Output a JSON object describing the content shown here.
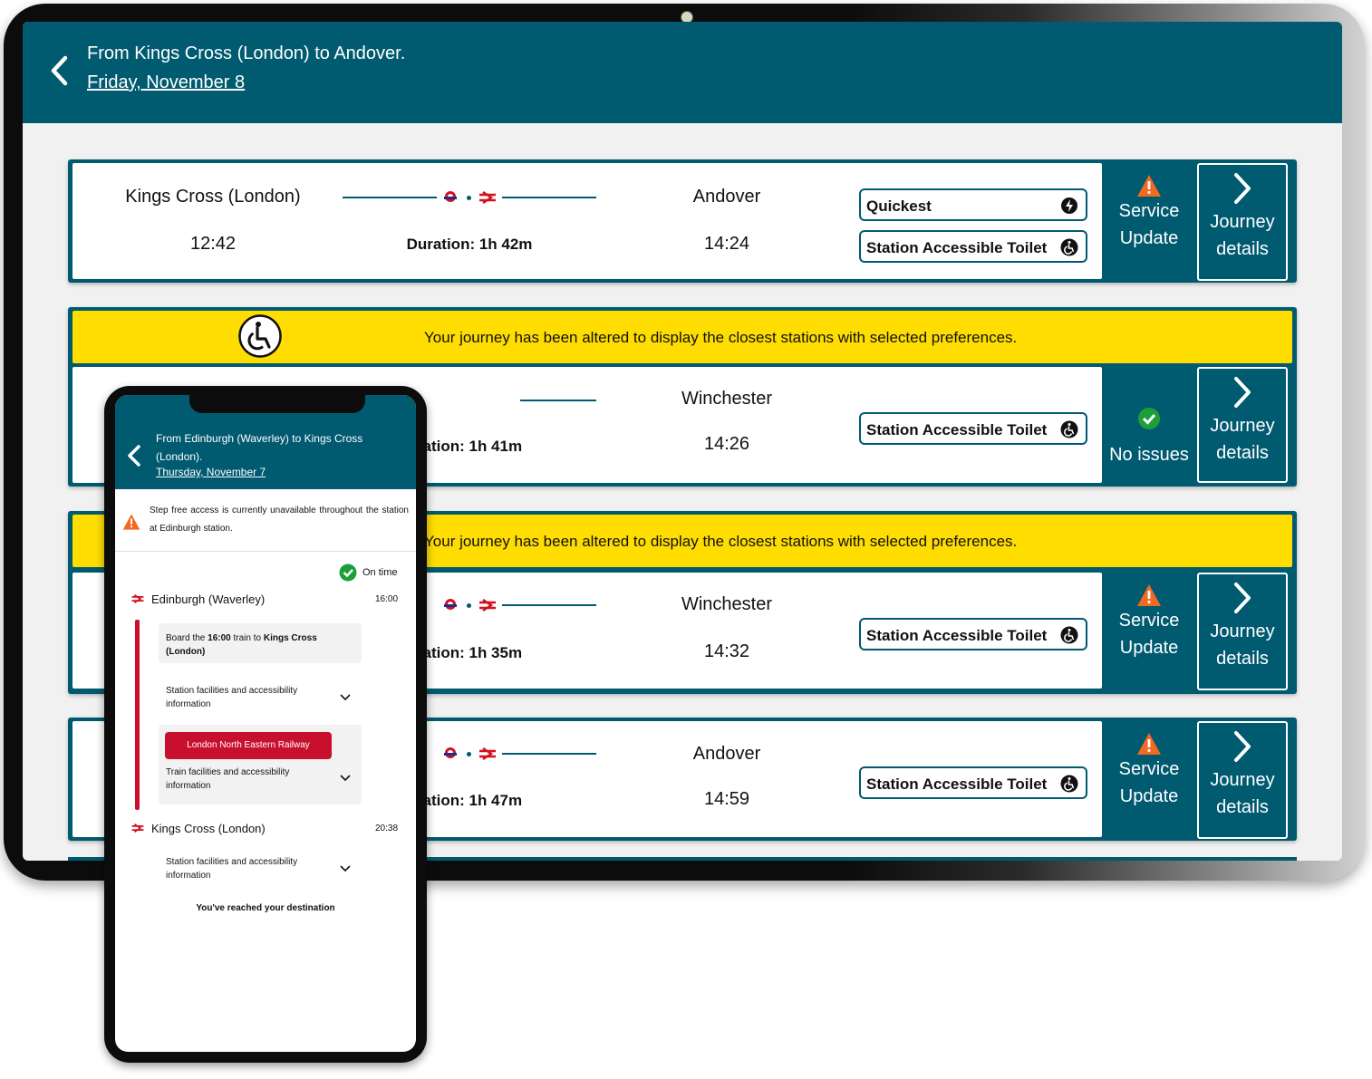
{
  "tablet": {
    "header": {
      "title": "From Kings Cross (London) to Andover.",
      "date": "Friday, November 8"
    },
    "banner_text": "Your journey has been altered to display the closest stations with selected preferences.",
    "journeys": [
      {
        "from": "Kings Cross (London)",
        "depart": "12:42",
        "duration": "Duration: 1h 42m",
        "to": "Andover",
        "arrive": "14:24",
        "tags": [
          "Quickest",
          "Station Accessible Toilet"
        ],
        "status": [
          "Service",
          "Update"
        ],
        "details": [
          "Journey",
          "details"
        ]
      },
      {
        "duration": "ration: 1h 41m",
        "to": "Winchester",
        "arrive": "14:26",
        "tags": [
          "Station Accessible Toilet"
        ],
        "status": [
          "No issues"
        ],
        "details": [
          "Journey",
          "details"
        ]
      },
      {
        "duration": "ration: 1h 35m",
        "to": "Winchester",
        "arrive": "14:32",
        "tags": [
          "Station Accessible Toilet"
        ],
        "status": [
          "Service",
          "Update"
        ],
        "details": [
          "Journey",
          "details"
        ]
      },
      {
        "duration": "ration: 1h 47m",
        "to": "Andover",
        "arrive": "14:59",
        "tags": [
          "Station Accessible Toilet"
        ],
        "status": [
          "Service",
          "Update"
        ],
        "details": [
          "Journey",
          "details"
        ]
      }
    ]
  },
  "phone": {
    "header": {
      "title": "From Edinburgh (Waverley) to Kings Cross (London).",
      "date": "Thursday, November 7"
    },
    "alert": "Step free access is currently unavailable throughout the station at Edinburgh station.",
    "on_time": "On time",
    "origin": {
      "name": "Edinburgh (Waverley)",
      "time": "16:00"
    },
    "board": {
      "prefix": "Board the ",
      "time": "16:00",
      "mid": " train to ",
      "dest": "Kings Cross (London)"
    },
    "station_facilities": "Station facilities and accessibility information",
    "operator": "London North Eastern Railway",
    "train_facilities": "Train facilities and accessibility information",
    "destination": {
      "name": "Kings Cross (London)",
      "time": "20:38"
    },
    "station_facilities_2": "Station facilities and accessibility information",
    "reached": "You've reached your destination"
  },
  "colors": {
    "brand": "#005a70",
    "banner": "#ffdd00",
    "warning": "#f26a21",
    "ok": "#1e9e3a",
    "rail_red": "#c8102e"
  },
  "icons": [
    "back-chevron-icon",
    "tube-roundel-icon",
    "national-rail-icon",
    "lightning-icon",
    "accessible-toilet-icon",
    "warning-icon",
    "check-circle-icon",
    "chevron-right-icon",
    "wheelchair-icon",
    "chevron-down-icon"
  ]
}
